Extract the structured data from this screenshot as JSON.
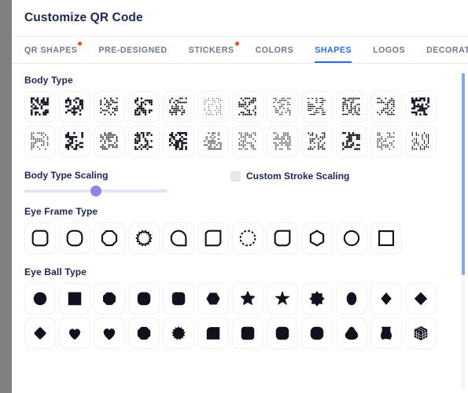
{
  "header": {
    "title": "Customize QR Code"
  },
  "tabs": [
    {
      "label": "QR SHAPES",
      "active": false,
      "badge": true
    },
    {
      "label": "PRE-DESIGNED",
      "active": false,
      "badge": false
    },
    {
      "label": "STICKERS",
      "active": false,
      "badge": true
    },
    {
      "label": "COLORS",
      "active": false,
      "badge": false
    },
    {
      "label": "SHAPES",
      "active": true,
      "badge": false
    },
    {
      "label": "LOGOS",
      "active": false,
      "badge": false
    },
    {
      "label": "DECORATE YOU",
      "active": false,
      "badge": false
    }
  ],
  "sections": {
    "body_type": {
      "title": "Body Type",
      "items": [
        {
          "name": "body-square",
          "icon": "qr-pattern-1"
        },
        {
          "name": "body-mosaic",
          "icon": "qr-pattern-2"
        },
        {
          "name": "body-dot",
          "icon": "qr-pattern-3"
        },
        {
          "name": "body-rounded",
          "icon": "qr-pattern-4"
        },
        {
          "name": "body-circle",
          "icon": "qr-pattern-5"
        },
        {
          "name": "body-tiny-dot",
          "icon": "qr-pattern-6"
        },
        {
          "name": "body-diamond",
          "icon": "qr-pattern-7"
        },
        {
          "name": "body-star",
          "icon": "qr-pattern-8"
        },
        {
          "name": "body-line-horizontal",
          "icon": "qr-pattern-9"
        },
        {
          "name": "body-cross",
          "icon": "qr-pattern-10"
        },
        {
          "name": "body-sparkle",
          "icon": "qr-pattern-11"
        },
        {
          "name": "body-block",
          "icon": "qr-pattern-12"
        },
        {
          "name": "body-scatter",
          "icon": "qr-pattern-13"
        },
        {
          "name": "body-dense",
          "icon": "qr-pattern-14"
        },
        {
          "name": "body-plus",
          "icon": "qr-pattern-15"
        },
        {
          "name": "body-pill",
          "icon": "qr-pattern-16"
        },
        {
          "name": "body-leaf",
          "icon": "qr-pattern-17"
        },
        {
          "name": "body-pot",
          "icon": "qr-pattern-18"
        },
        {
          "name": "body-swirl",
          "icon": "qr-pattern-19"
        },
        {
          "name": "body-wave",
          "icon": "qr-pattern-20"
        },
        {
          "name": "body-mesh",
          "icon": "qr-pattern-21"
        },
        {
          "name": "body-chunk",
          "icon": "qr-pattern-22"
        },
        {
          "name": "body-confetti",
          "icon": "qr-pattern-23"
        },
        {
          "name": "body-bars",
          "icon": "qr-pattern-24"
        }
      ]
    },
    "body_type_scaling": {
      "label": "Body Type Scaling",
      "value_percent": 50
    },
    "custom_stroke_scaling": {
      "label": "Custom Stroke Scaling",
      "checked": false
    },
    "eye_frame_type": {
      "title": "Eye Frame Type",
      "items": [
        {
          "name": "eye-frame-rounded-square",
          "icon": "frame-rounded-square"
        },
        {
          "name": "eye-frame-squircle",
          "icon": "frame-squircle"
        },
        {
          "name": "eye-frame-octagon",
          "icon": "frame-octagon"
        },
        {
          "name": "eye-frame-gear",
          "icon": "frame-gear"
        },
        {
          "name": "eye-frame-leaf-left",
          "icon": "frame-leaf-left"
        },
        {
          "name": "eye-frame-leaf-right",
          "icon": "frame-leaf-right"
        },
        {
          "name": "eye-frame-dashed-circle",
          "icon": "frame-dashed-circle"
        },
        {
          "name": "eye-frame-teardrop",
          "icon": "frame-teardrop"
        },
        {
          "name": "eye-frame-hexagon",
          "icon": "frame-hexagon"
        },
        {
          "name": "eye-frame-circle",
          "icon": "frame-circle"
        },
        {
          "name": "eye-frame-square",
          "icon": "frame-square"
        }
      ]
    },
    "eye_ball_type": {
      "title": "Eye Ball Type",
      "items": [
        {
          "name": "eye-ball-circle",
          "icon": "ball-circle"
        },
        {
          "name": "eye-ball-square",
          "icon": "ball-square"
        },
        {
          "name": "eye-ball-octagon",
          "icon": "ball-octagon"
        },
        {
          "name": "eye-ball-rounded",
          "icon": "ball-rounded"
        },
        {
          "name": "eye-ball-squircle",
          "icon": "ball-squircle"
        },
        {
          "name": "eye-ball-hexagon",
          "icon": "ball-hexagon"
        },
        {
          "name": "eye-ball-star-5",
          "icon": "ball-star-5"
        },
        {
          "name": "eye-ball-star-5b",
          "icon": "ball-star-5b"
        },
        {
          "name": "eye-ball-star-7",
          "icon": "ball-star-7"
        },
        {
          "name": "eye-ball-ellipse",
          "icon": "ball-ellipse"
        },
        {
          "name": "eye-ball-diamond",
          "icon": "ball-diamond"
        },
        {
          "name": "eye-ball-diamond-wide",
          "icon": "ball-diamond-wide"
        },
        {
          "name": "eye-ball-diamond-round",
          "icon": "ball-diamond-round"
        },
        {
          "name": "eye-ball-heart",
          "icon": "ball-heart"
        },
        {
          "name": "eye-ball-heart-2",
          "icon": "ball-heart-2"
        },
        {
          "name": "eye-ball-octagon-2",
          "icon": "ball-octagon-2"
        },
        {
          "name": "eye-ball-flower",
          "icon": "ball-flower"
        },
        {
          "name": "eye-ball-rounded-tl",
          "icon": "ball-rounded-tl"
        },
        {
          "name": "eye-ball-rounded-tr",
          "icon": "ball-rounded-tr"
        },
        {
          "name": "eye-ball-rounded-br",
          "icon": "ball-rounded-br"
        },
        {
          "name": "eye-ball-rounded-bl",
          "icon": "ball-rounded-bl"
        },
        {
          "name": "eye-ball-blob",
          "icon": "ball-blob"
        },
        {
          "name": "eye-ball-shield",
          "icon": "ball-shield"
        },
        {
          "name": "eye-ball-cube",
          "icon": "ball-cube"
        }
      ]
    }
  },
  "scrollbar": {
    "thumb_top_percent": 0,
    "thumb_size_percent": 64
  },
  "colors": {
    "accent": "#2b6cf6",
    "badge": "#f04a16",
    "title": "#1b2559",
    "tab_inactive": "#6f7890",
    "slider_thumb": "#8c86e8",
    "scrollbar_thumb": "#7ea6f9"
  }
}
